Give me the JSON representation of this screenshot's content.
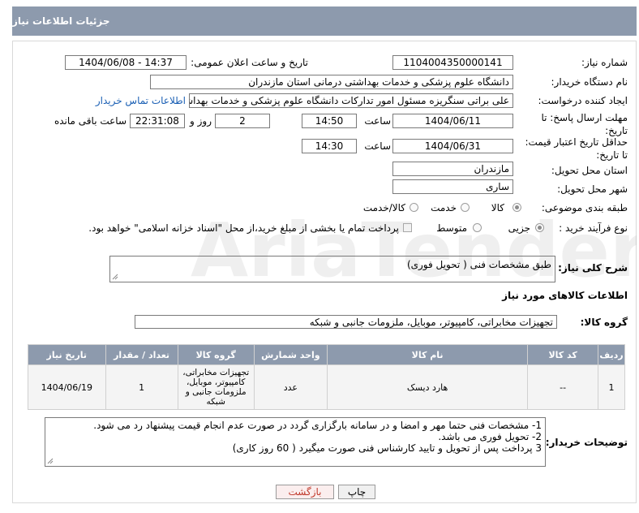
{
  "header": {
    "title": "جزئیات اطلاعات نیاز"
  },
  "need_number": {
    "label": "شماره نیاز:",
    "value": "1104004350000141"
  },
  "announce": {
    "label": "تاریخ و ساعت اعلان عمومی:",
    "value": "1404/06/08 - 14:37"
  },
  "buyer_org": {
    "label": "نام دستگاه خریدار:",
    "value": "دانشگاه علوم پزشکی و خدمات بهداشتی  درمانی استان مازندران"
  },
  "requester": {
    "label": "ایجاد کننده درخواست:",
    "value": "علی براتی سنگریزه مسئول امور تدارکات دانشگاه علوم پزشکی و خدمات بهداشتی",
    "contact_link": "اطلاعات تماس خریدار"
  },
  "deadline": {
    "label_line1": "مهلت ارسال پاسخ: تا",
    "label_line2": "تاریخ:",
    "date": "1404/06/11",
    "time_label": "ساعت",
    "time": "14:50",
    "days": "2",
    "days_label": "روز و",
    "remaining": "22:31:08",
    "remaining_label": "ساعت باقی مانده"
  },
  "validity": {
    "label_line1": "حداقل تاریخ اعتبار قیمت:",
    "label_line2": "تا تاریخ:",
    "date": "1404/06/31",
    "time_label": "ساعت",
    "time": "14:30"
  },
  "province": {
    "label": "استان محل تحویل:",
    "value": "مازندران"
  },
  "city": {
    "label": "شهر محل تحویل:",
    "value": "ساری"
  },
  "category": {
    "label": "طبقه بندی موضوعی:",
    "options": [
      "کالا",
      "خدمت",
      "کالا/خدمت"
    ],
    "selected": "کالا"
  },
  "purchase_type": {
    "label": "نوع فرآیند خرید :",
    "options": [
      "جزیی",
      "متوسط"
    ],
    "selected": "جزیی",
    "payment_note": "پرداخت تمام یا بخشی از مبلغ خرید،از محل \"اسناد خزانه اسلامی\" خواهد بود."
  },
  "summary": {
    "label": "شرح کلی نیاز:",
    "value": "طبق مشخصات فنی ( تحویل فوری)"
  },
  "goods_section": {
    "title": "اطلاعات کالاهای مورد نیاز"
  },
  "goods_group": {
    "label": "گروه کالا:",
    "value": "تجهیزات مخابراتی، کامپیوتر، موبایل، ملزومات جانبی و شبکه"
  },
  "table": {
    "headers": [
      "ردیف",
      "کد کالا",
      "نام کالا",
      "واحد شمارش",
      "گروه کالا",
      "تعداد / مقدار",
      "تاریخ نیاز"
    ],
    "rows": [
      {
        "row": "1",
        "code": "--",
        "name": "هارد دیسک",
        "unit": "عدد",
        "group": "تجهیزات مخابراتی، کامپیوتر، موبایل، ملزومات جانبی و شبکه",
        "qty": "1",
        "date": "1404/06/19"
      }
    ]
  },
  "buyer_notes": {
    "label": "توضیحات خریدار:",
    "lines": [
      "1- مشخصات فنی حتما مهر و امضا و در سامانه بارگزاری گردد در صورت عدم انجام قیمت پیشنهاد رد می شود.",
      "2- تحویل فوری می باشد.",
      "3 پرداخت پس از تحویل و تایید کارشناس فنی صورت میگیرد ( 60 روز کاری)"
    ]
  },
  "buttons": {
    "print": "چاپ",
    "back": "بازگشت"
  },
  "watermark": {
    "text": "AriaTender.net"
  },
  "colors": {
    "header_bg": "#8d9aad",
    "link": "#1a5fb4",
    "back_button_text": "#c0392b"
  }
}
